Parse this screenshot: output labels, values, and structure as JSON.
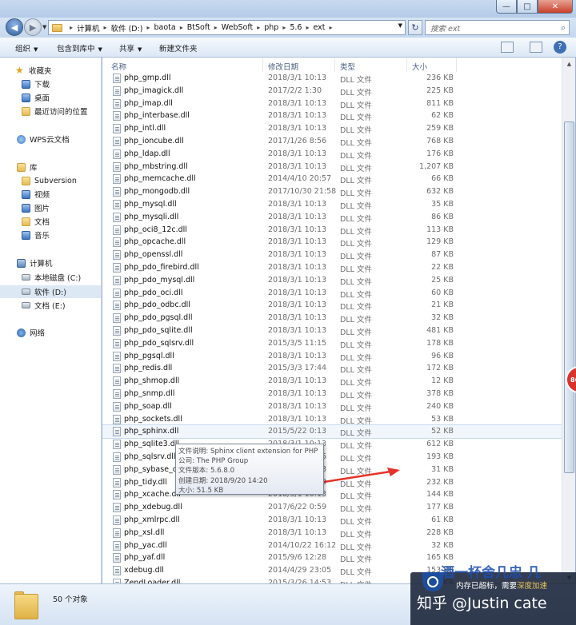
{
  "window": {
    "buttons": {
      "minimize": "—",
      "maximize": "□",
      "close": "✕"
    }
  },
  "address": {
    "crumbs": [
      "计算机",
      "软件 (D:)",
      "baota",
      "BtSoft",
      "WebSoft",
      "php",
      "5.6",
      "ext"
    ],
    "search_placeholder": "搜索 ext"
  },
  "commands": {
    "organize": "组织",
    "include": "包含到库中",
    "share": "共享",
    "new_folder": "新建文件夹"
  },
  "nav": {
    "favorites": "收藏夹",
    "downloads": "下载",
    "desktop": "桌面",
    "recent": "最近访问的位置",
    "wps": "WPS云文档",
    "libraries": "库",
    "subversion": "Subversion",
    "videos": "视频",
    "pictures": "图片",
    "documents": "文档",
    "music": "音乐",
    "computer": "计算机",
    "drive_c": "本地磁盘 (C:)",
    "drive_d": "软件 (D:)",
    "drive_e": "文档 (E:)",
    "network": "网络"
  },
  "columns": {
    "name": "名称",
    "modified": "修改日期",
    "type": "类型",
    "size": "大小"
  },
  "files": [
    {
      "name": "php_gmp.dll",
      "date": "2018/3/1 10:13",
      "type": "DLL 文件",
      "size": "236 KB"
    },
    {
      "name": "php_imagick.dll",
      "date": "2017/2/2 1:30",
      "type": "DLL 文件",
      "size": "225 KB"
    },
    {
      "name": "php_imap.dll",
      "date": "2018/3/1 10:13",
      "type": "DLL 文件",
      "size": "811 KB"
    },
    {
      "name": "php_interbase.dll",
      "date": "2018/3/1 10:13",
      "type": "DLL 文件",
      "size": "62 KB"
    },
    {
      "name": "php_intl.dll",
      "date": "2018/3/1 10:13",
      "type": "DLL 文件",
      "size": "259 KB"
    },
    {
      "name": "php_ioncube.dll",
      "date": "2017/1/26 8:56",
      "type": "DLL 文件",
      "size": "768 KB"
    },
    {
      "name": "php_ldap.dll",
      "date": "2018/3/1 10:13",
      "type": "DLL 文件",
      "size": "176 KB"
    },
    {
      "name": "php_mbstring.dll",
      "date": "2018/3/1 10:13",
      "type": "DLL 文件",
      "size": "1,207 KB"
    },
    {
      "name": "php_memcache.dll",
      "date": "2014/4/10 20:57",
      "type": "DLL 文件",
      "size": "66 KB"
    },
    {
      "name": "php_mongodb.dll",
      "date": "2017/10/30 21:58",
      "type": "DLL 文件",
      "size": "632 KB"
    },
    {
      "name": "php_mysql.dll",
      "date": "2018/3/1 10:13",
      "type": "DLL 文件",
      "size": "35 KB"
    },
    {
      "name": "php_mysqli.dll",
      "date": "2018/3/1 10:13",
      "type": "DLL 文件",
      "size": "86 KB"
    },
    {
      "name": "php_oci8_12c.dll",
      "date": "2018/3/1 10:13",
      "type": "DLL 文件",
      "size": "113 KB"
    },
    {
      "name": "php_opcache.dll",
      "date": "2018/3/1 10:13",
      "type": "DLL 文件",
      "size": "129 KB"
    },
    {
      "name": "php_openssl.dll",
      "date": "2018/3/1 10:13",
      "type": "DLL 文件",
      "size": "87 KB"
    },
    {
      "name": "php_pdo_firebird.dll",
      "date": "2018/3/1 10:13",
      "type": "DLL 文件",
      "size": "22 KB"
    },
    {
      "name": "php_pdo_mysql.dll",
      "date": "2018/3/1 10:13",
      "type": "DLL 文件",
      "size": "25 KB"
    },
    {
      "name": "php_pdo_oci.dll",
      "date": "2018/3/1 10:13",
      "type": "DLL 文件",
      "size": "60 KB"
    },
    {
      "name": "php_pdo_odbc.dll",
      "date": "2018/3/1 10:13",
      "type": "DLL 文件",
      "size": "21 KB"
    },
    {
      "name": "php_pdo_pgsql.dll",
      "date": "2018/3/1 10:13",
      "type": "DLL 文件",
      "size": "32 KB"
    },
    {
      "name": "php_pdo_sqlite.dll",
      "date": "2018/3/1 10:13",
      "type": "DLL 文件",
      "size": "481 KB"
    },
    {
      "name": "php_pdo_sqlsrv.dll",
      "date": "2015/3/5 11:15",
      "type": "DLL 文件",
      "size": "178 KB"
    },
    {
      "name": "php_pgsql.dll",
      "date": "2018/3/1 10:13",
      "type": "DLL 文件",
      "size": "96 KB"
    },
    {
      "name": "php_redis.dll",
      "date": "2015/3/3 17:44",
      "type": "DLL 文件",
      "size": "172 KB"
    },
    {
      "name": "php_shmop.dll",
      "date": "2018/3/1 10:13",
      "type": "DLL 文件",
      "size": "12 KB"
    },
    {
      "name": "php_snmp.dll",
      "date": "2018/3/1 10:13",
      "type": "DLL 文件",
      "size": "378 KB"
    },
    {
      "name": "php_soap.dll",
      "date": "2018/3/1 10:13",
      "type": "DLL 文件",
      "size": "240 KB"
    },
    {
      "name": "php_sockets.dll",
      "date": "2018/3/1 10:13",
      "type": "DLL 文件",
      "size": "53 KB"
    },
    {
      "name": "php_sphinx.dll",
      "date": "2015/5/22 0:13",
      "type": "DLL 文件",
      "size": "52 KB"
    },
    {
      "name": "php_sqlite3.dll",
      "date": "2018/3/1 10:13",
      "type": "DLL 文件",
      "size": "612 KB"
    },
    {
      "name": "php_sqlsrv.dll",
      "date": "2015/3/5 11:15",
      "type": "DLL 文件",
      "size": "193 KB"
    },
    {
      "name": "php_sybase_ct.dll",
      "date": "2018/3/1 10:13",
      "type": "DLL 文件",
      "size": "31 KB"
    },
    {
      "name": "php_tidy.dll",
      "date": "2018/3/1 10:13",
      "type": "DLL 文件",
      "size": "232 KB"
    },
    {
      "name": "php_xcache.dll",
      "date": "2018/3/1 10:13",
      "type": "DLL 文件",
      "size": "144 KB"
    },
    {
      "name": "php_xdebug.dll",
      "date": "2017/6/22 0:59",
      "type": "DLL 文件",
      "size": "177 KB"
    },
    {
      "name": "php_xmlrpc.dll",
      "date": "2018/3/1 10:13",
      "type": "DLL 文件",
      "size": "61 KB"
    },
    {
      "name": "php_xsl.dll",
      "date": "2018/3/1 10:13",
      "type": "DLL 文件",
      "size": "228 KB"
    },
    {
      "name": "php_yac.dll",
      "date": "2014/10/22 16:12",
      "type": "DLL 文件",
      "size": "32 KB"
    },
    {
      "name": "php_yaf.dll",
      "date": "2015/9/6 12:28",
      "type": "DLL 文件",
      "size": "165 KB"
    },
    {
      "name": "xdebug.dll",
      "date": "2014/4/29 23:05",
      "type": "DLL 文件",
      "size": "153 KB"
    },
    {
      "name": "ZendLoader.dll",
      "date": "2015/3/26 14:53",
      "type": "DLL 文件",
      "size": "149 KB"
    }
  ],
  "tooltip": {
    "desc": "文件说明: Sphinx client extension for PHP",
    "company": "公司: The PHP Group",
    "version": "文件版本: 5.6.8.0",
    "created": "创建日期: 2018/9/20 14:20",
    "size": "大小: 51.5 KB"
  },
  "status": {
    "count": "50 个对象"
  },
  "overlay": {
    "note_prefix": "内存已超标，需要",
    "note_link": "深度加速",
    "watermark": "知乎 @Justin cate",
    "faint_text": "酒一杯舍几忠 几",
    "badge": "86"
  }
}
